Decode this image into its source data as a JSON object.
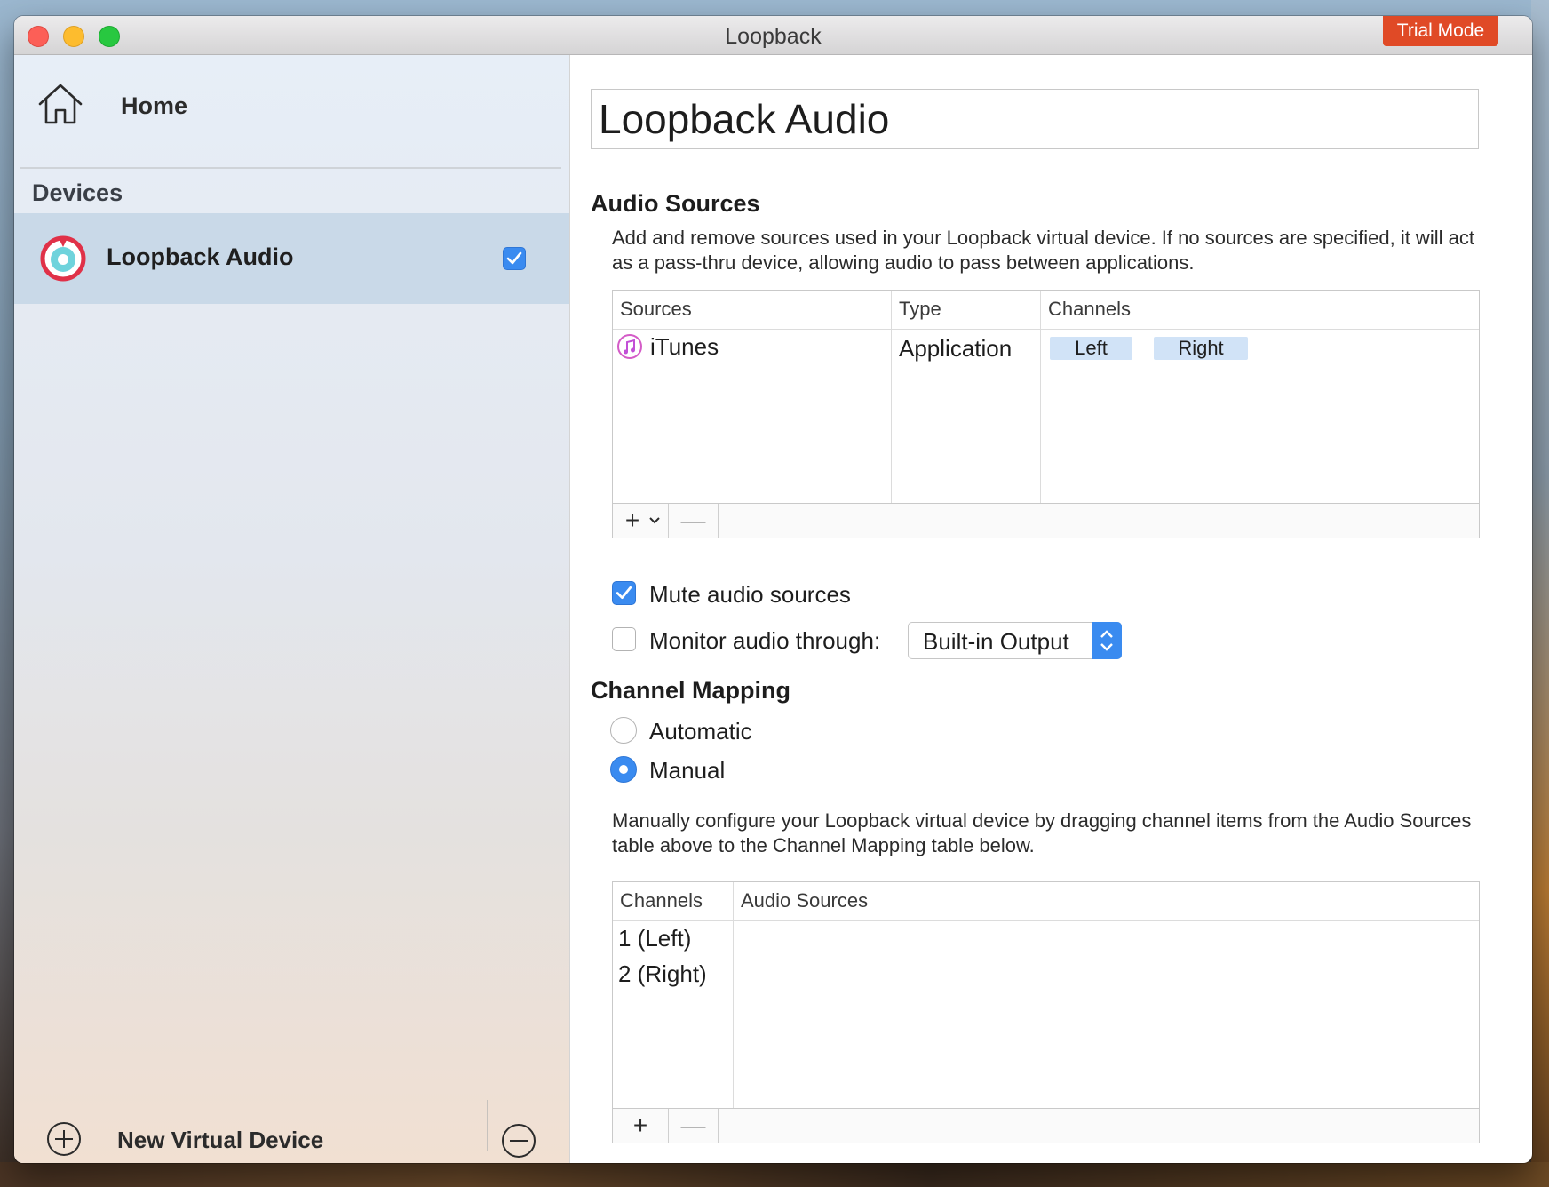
{
  "window": {
    "title": "Loopback",
    "trial_badge": "Trial Mode"
  },
  "sidebar": {
    "home_label": "Home",
    "devices_header": "Devices",
    "devices": [
      {
        "label": "Loopback Audio",
        "enabled": true
      }
    ],
    "new_device_label": "New Virtual Device"
  },
  "main": {
    "device_name": "Loopback Audio",
    "audio_sources": {
      "title": "Audio Sources",
      "description": "Add and remove sources used in your Loopback virtual device. If no sources are specified, it will act as a pass-thru device, allowing audio to pass between applications.",
      "columns": [
        "Sources",
        "Type",
        "Channels"
      ],
      "rows": [
        {
          "source": "iTunes",
          "type": "Application",
          "channels": [
            "Left",
            "Right"
          ]
        }
      ],
      "add_glyph": "+",
      "remove_glyph": "—"
    },
    "mute_sources": {
      "label": "Mute audio sources",
      "checked": true
    },
    "monitor": {
      "label": "Monitor audio through:",
      "checked": false,
      "selected": "Built-in Output"
    },
    "channel_mapping": {
      "title": "Channel Mapping",
      "options": [
        {
          "label": "Automatic",
          "selected": false
        },
        {
          "label": "Manual",
          "selected": true
        }
      ],
      "description": "Manually configure your Loopback virtual device by dragging channel items from the Audio Sources table above to the Channel Mapping table below.",
      "columns": [
        "Channels",
        "Audio Sources"
      ],
      "rows": [
        "1 (Left)",
        "2 (Right)"
      ],
      "add_glyph": "+",
      "remove_glyph": "—"
    }
  },
  "colors": {
    "accent": "#3a8bf0",
    "trial": "#e04a26",
    "selection": "#c9d9e8",
    "channel_pill": "#d1e3f7"
  }
}
